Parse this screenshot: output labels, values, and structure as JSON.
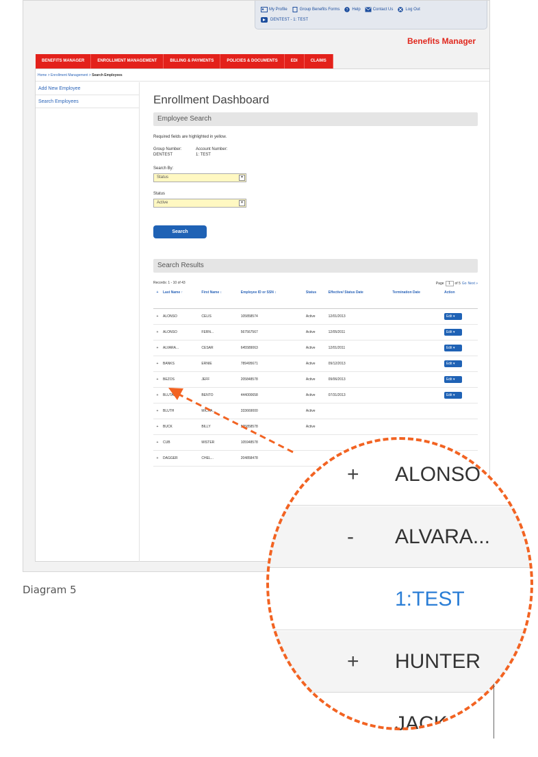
{
  "topbar": {
    "links": [
      "My Profile",
      "Group Benefits Forms",
      "Help",
      "Contact Us",
      "Log Out"
    ],
    "account_selector": "DENTEST - 1: TEST"
  },
  "app_title": "Benefits Manager",
  "nav": [
    "BENEFITS MANAGER",
    "ENROLLMENT MANAGEMENT",
    "BILLING & PAYMENTS",
    "POLICIES & DOCUMENTS",
    "EDI",
    "CLAIMS"
  ],
  "breadcrumb": {
    "home": "Home",
    "sep1": " > ",
    "mid": "Enrollment Management",
    "sep2": " > ",
    "current": "Search Employees"
  },
  "sidebar": [
    "Add New Employee",
    "Search Employees"
  ],
  "page_title": "Enrollment Dashboard",
  "search_section": {
    "heading": "Employee Search",
    "required_note": "Required fields are highlighted in yellow.",
    "group_label": "Group Number:",
    "group_value": "DENTEST",
    "account_label": "Account Number:",
    "account_value": "1: TEST",
    "search_by_label": "Search By:",
    "search_by_value": "Status",
    "status_label": "Status",
    "status_value": "Active",
    "button": "Search"
  },
  "results": {
    "heading": "Search Results",
    "records": "Records: 1 - 10 of 43",
    "page_label": "Page",
    "page_value": "1",
    "page_of": "of 5",
    "go": "Go",
    "next": "Next »",
    "columns": [
      "+",
      "Last Name ↑",
      "First Name ↕",
      "Employee ID or SSN ↕",
      "Status",
      "Effective/ Status Date",
      "Termination Date",
      "Action"
    ],
    "edit_label": "Edit ▾",
    "rows": [
      {
        "pm": "+",
        "last": "ALONSO",
        "first": "CELIS",
        "id": "105858574",
        "status": "Active",
        "eff": "12/01/2013",
        "term": ""
      },
      {
        "pm": "+",
        "last": "ALONSO",
        "first": "FERN...",
        "id": "567567567",
        "status": "Active",
        "eff": "12/05/2011",
        "term": ""
      },
      {
        "pm": "+",
        "last": "ALVARA...",
        "first": "CESAR",
        "id": "645589063",
        "status": "Active",
        "eff": "12/01/2011",
        "term": ""
      },
      {
        "pm": "+",
        "last": "BANKS",
        "first": "ERNIE",
        "id": "789495671",
        "status": "Active",
        "eff": "09/12/2013",
        "term": ""
      },
      {
        "pm": "+",
        "last": "BEZOS",
        "first": "JEFF",
        "id": "205848578",
        "status": "Active",
        "eff": "09/06/2013",
        "term": ""
      },
      {
        "pm": "+",
        "last": "BLUTAR...",
        "first": "BENTO",
        "id": "444000658",
        "status": "Active",
        "eff": "07/31/2013",
        "term": ""
      },
      {
        "pm": "+",
        "last": "BLUTH",
        "first": "MICHA...",
        "id": "333669000",
        "status": "Active",
        "eff": "",
        "term": ""
      },
      {
        "pm": "+",
        "last": "BUCK",
        "first": "BILLY",
        "id": "505858578",
        "status": "Active",
        "eff": "",
        "term": ""
      },
      {
        "pm": "+",
        "last": "CUB",
        "first": "MISTER",
        "id": "105948578",
        "status": "",
        "eff": "",
        "term": ""
      },
      {
        "pm": "+",
        "last": "DAGGER",
        "first": "CHEL...",
        "id": "204858478",
        "status": "",
        "eff": "",
        "term": ""
      }
    ]
  },
  "zoom": {
    "rows": [
      {
        "pm": "+",
        "text": "ALONSO"
      },
      {
        "pm": "-",
        "text": "ALVARA..."
      },
      {
        "pm": "",
        "text": "1:TEST"
      },
      {
        "pm": "+",
        "text": "HUNTER"
      },
      {
        "pm": "",
        "text": "JACK"
      }
    ],
    "accent_color": "#f26322"
  },
  "caption": "Diagram 5"
}
